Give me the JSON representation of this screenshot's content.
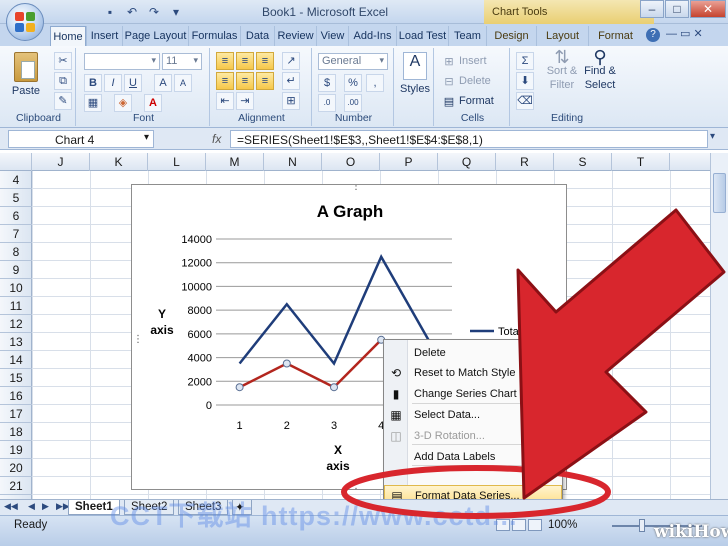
{
  "window": {
    "title": "Book1 - Microsoft Excel",
    "tools_title": "Chart Tools"
  },
  "tabs": [
    "Home",
    "Insert",
    "Page Layout",
    "Formulas",
    "Data",
    "Review",
    "View",
    "Add-Ins",
    "Load Test",
    "Team",
    "Design",
    "Layout",
    "Format"
  ],
  "ribbon": {
    "clipboard": {
      "label": "Clipboard",
      "paste": "Paste"
    },
    "font": {
      "label": "Font",
      "size": "11"
    },
    "alignment": {
      "label": "Alignment"
    },
    "number": {
      "label": "Number",
      "format": "General",
      "currency": "$",
      "percent": "%",
      "comma": ","
    },
    "styles": {
      "label": "Styles"
    },
    "cells": {
      "label": "Cells",
      "insert": "Insert",
      "delete": "Delete",
      "format": "Format"
    },
    "editing": {
      "label": "Editing",
      "sort_line1": "Sort &",
      "sort_line2": "Filter",
      "find_line1": "Find &",
      "find_line2": "Select"
    }
  },
  "formula_bar": {
    "name_box": "Chart 4",
    "fx": "fx",
    "formula": "=SERIES(Sheet1!$E$3,,Sheet1!$E$4:$E$8,1)"
  },
  "grid": {
    "columns": [
      "J",
      "K",
      "L",
      "M",
      "N",
      "O",
      "P",
      "Q",
      "R",
      "S",
      "T"
    ],
    "rows": [
      "4",
      "5",
      "6",
      "7",
      "8",
      "9",
      "10",
      "11",
      "12",
      "13",
      "14",
      "15",
      "16",
      "17",
      "18",
      "19",
      "20",
      "21"
    ]
  },
  "chart_data": {
    "type": "line",
    "title": "A Graph",
    "xlabel": "X axis",
    "ylabel": "Y axis",
    "categories": [
      1,
      2,
      3,
      4,
      5
    ],
    "y_ticks": [
      "0",
      "2000",
      "4000",
      "6000",
      "8000",
      "10000",
      "12000",
      "14000"
    ],
    "ylim": [
      0,
      14000
    ],
    "series": [
      {
        "name": "Total",
        "values": [
          3500,
          8500,
          3500,
          12500,
          5500
        ],
        "color": "#1f3d7a"
      },
      {
        "name": "",
        "values": [
          1500,
          3500,
          1500,
          5500,
          3500
        ],
        "color": "#b3261e"
      }
    ],
    "legend": "right",
    "grid": true
  },
  "context_menu": {
    "items": [
      {
        "label": "Delete",
        "icon": "none",
        "disabled": false
      },
      {
        "label": "Reset to Match Style",
        "icon": "reset-style-icon",
        "disabled": false
      },
      {
        "label": "Change Series Chart Type...",
        "icon": "chart-type-icon",
        "disabled": false
      },
      {
        "label": "Select Data...",
        "icon": "select-data-icon",
        "disabled": false
      },
      {
        "label": "3-D Rotation...",
        "icon": "rotation-icon",
        "disabled": true
      },
      {
        "label": "Add Data Labels",
        "icon": "none",
        "disabled": false
      },
      {
        "label": "Add Trendline...",
        "icon": "none",
        "disabled": false
      },
      {
        "label": "Format Data Series...",
        "icon": "format-series-icon",
        "disabled": false
      }
    ]
  },
  "sheets": [
    "Sheet1",
    "Sheet2",
    "Sheet3"
  ],
  "status": {
    "text": "Ready",
    "zoom": "100%"
  },
  "watermark": "CCT下载站 https://www.cctd...",
  "wikihow": "wikiHow",
  "colors": {
    "arrow": "#d8262d",
    "highlight_ring": "#d8262d"
  }
}
